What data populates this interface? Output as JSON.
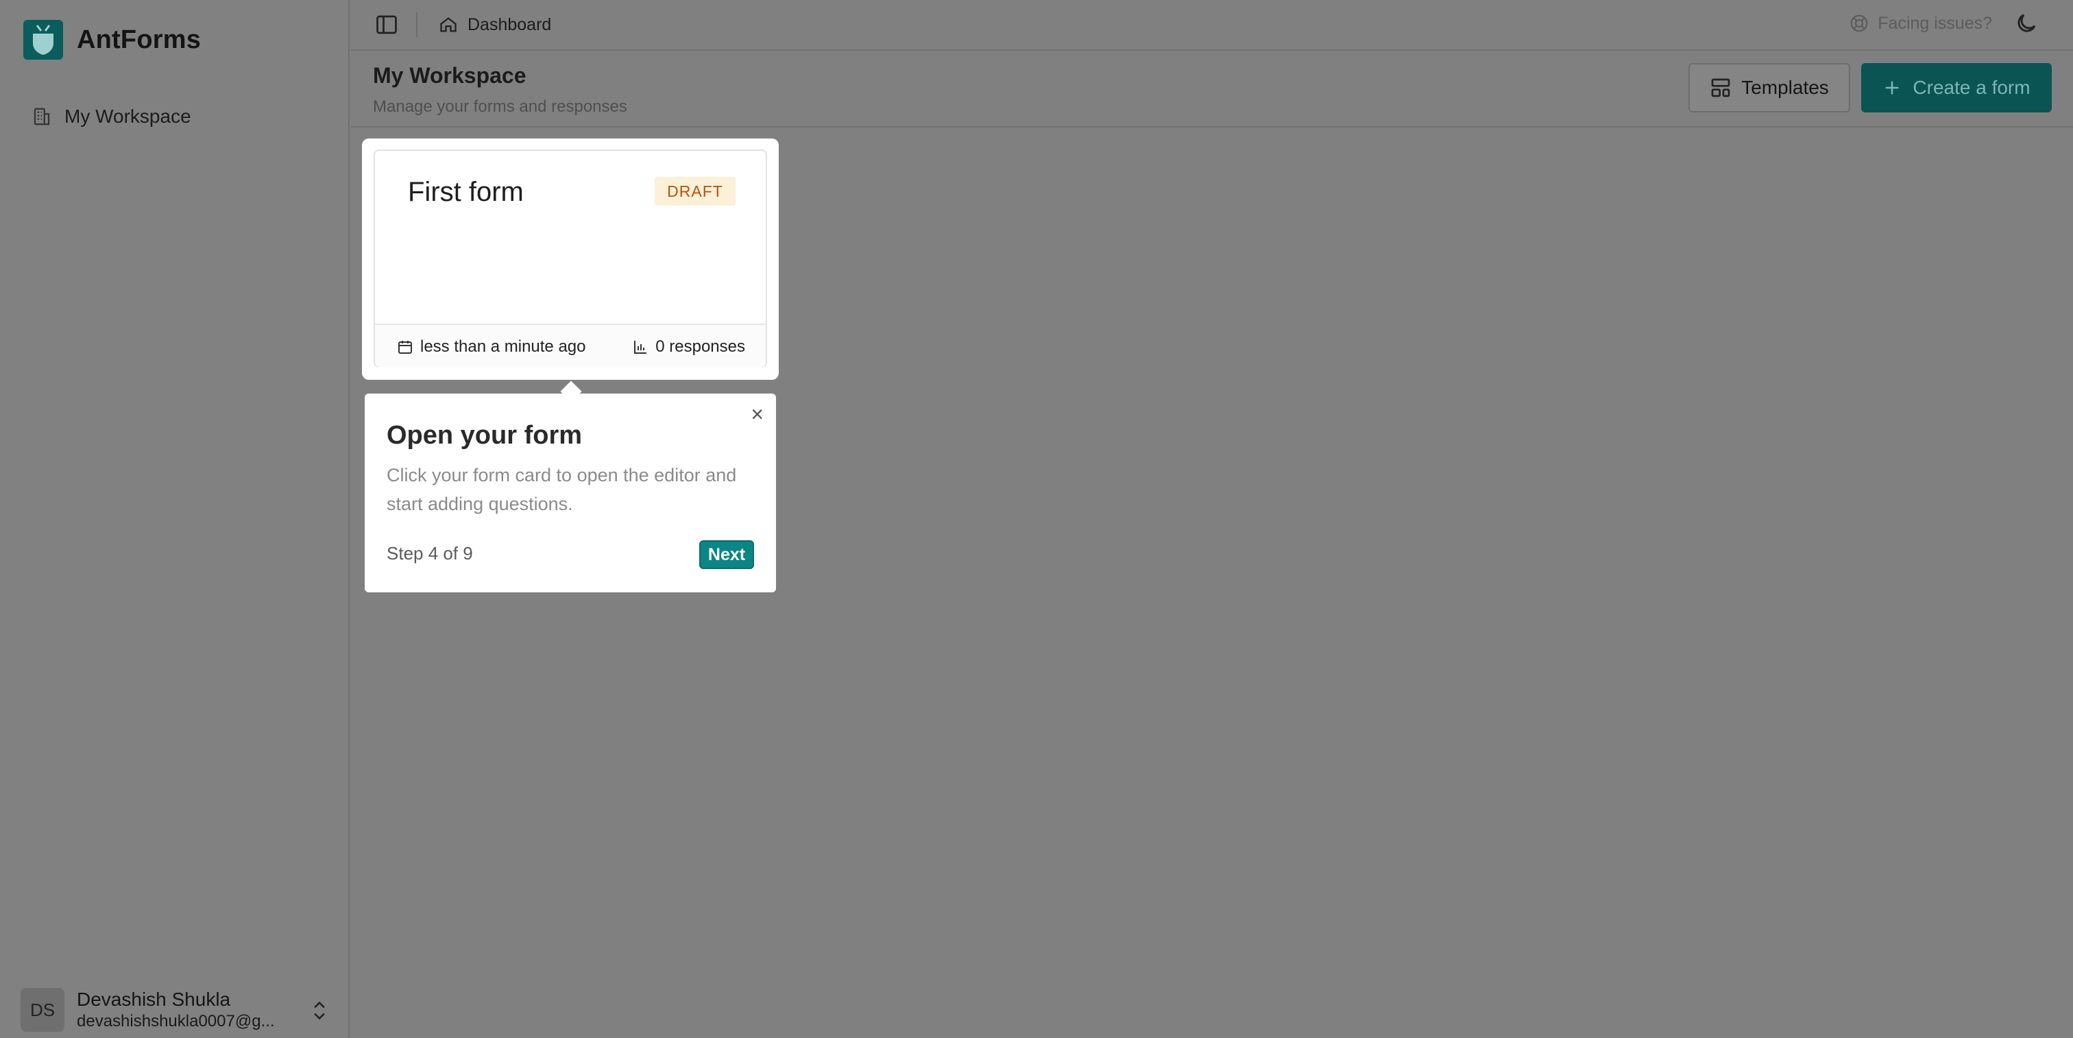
{
  "app": {
    "name": "AntForms"
  },
  "sidebar": {
    "items": [
      {
        "label": "My Workspace",
        "icon": "building-icon"
      }
    ],
    "user": {
      "initials": "DS",
      "name": "Devashish Shukla",
      "email": "devashishshukla0007@g..."
    }
  },
  "topbar": {
    "breadcrumb": "Dashboard",
    "issues_label": "Facing issues?"
  },
  "header": {
    "title": "My Workspace",
    "subtitle": "Manage your forms and responses",
    "templates_label": "Templates",
    "create_label": "Create a form"
  },
  "forms": [
    {
      "title": "First form",
      "status": "DRAFT",
      "updated": "less than a minute ago",
      "responses": "0 responses"
    }
  ],
  "tour": {
    "title": "Open your form",
    "description": "Click your form card to open the editor and start adding questions.",
    "step": "Step 4 of 9",
    "next_label": "Next",
    "close_glyph": "×"
  },
  "colors": {
    "brand": "#0b5c5c",
    "accent": "#0c8585",
    "draft_badge_bg": "#fdf0d8",
    "draft_badge_text": "#b4530a"
  }
}
